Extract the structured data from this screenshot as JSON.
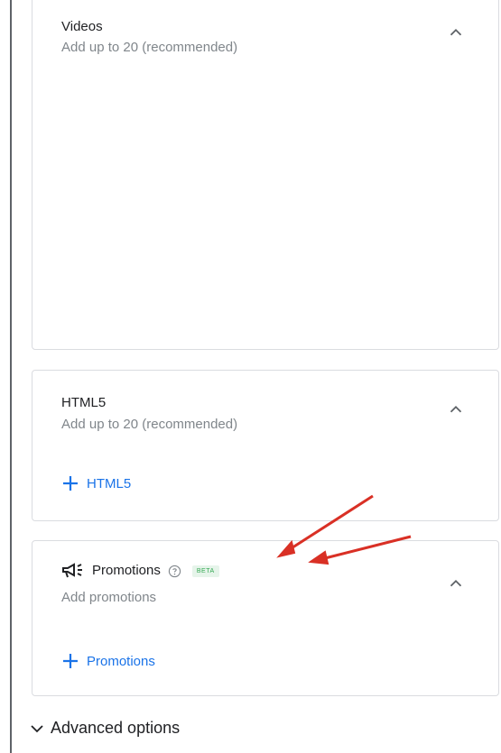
{
  "videos": {
    "title": "Videos",
    "subtitle": "Add up to 20 (recommended)"
  },
  "html5": {
    "title": "HTML5",
    "subtitle": "Add up to 20 (recommended)",
    "add_label": "HTML5"
  },
  "promotions": {
    "title": "Promotions",
    "badge": "BETA",
    "subtitle": "Add promotions",
    "add_label": "Promotions"
  },
  "advanced": {
    "label": "Advanced options"
  },
  "icons": {
    "collapse": "chevron-up-icon",
    "add": "plus-icon",
    "promotions": "megaphone-icon",
    "help": "help-circle-icon",
    "expand": "chevron-down-icon",
    "annotation": "red-arrow-annotation"
  },
  "colors": {
    "accent": "#1a73e8",
    "badge_bg": "#e6f4ea",
    "badge_text": "#34a853",
    "annotation": "#d93025"
  }
}
